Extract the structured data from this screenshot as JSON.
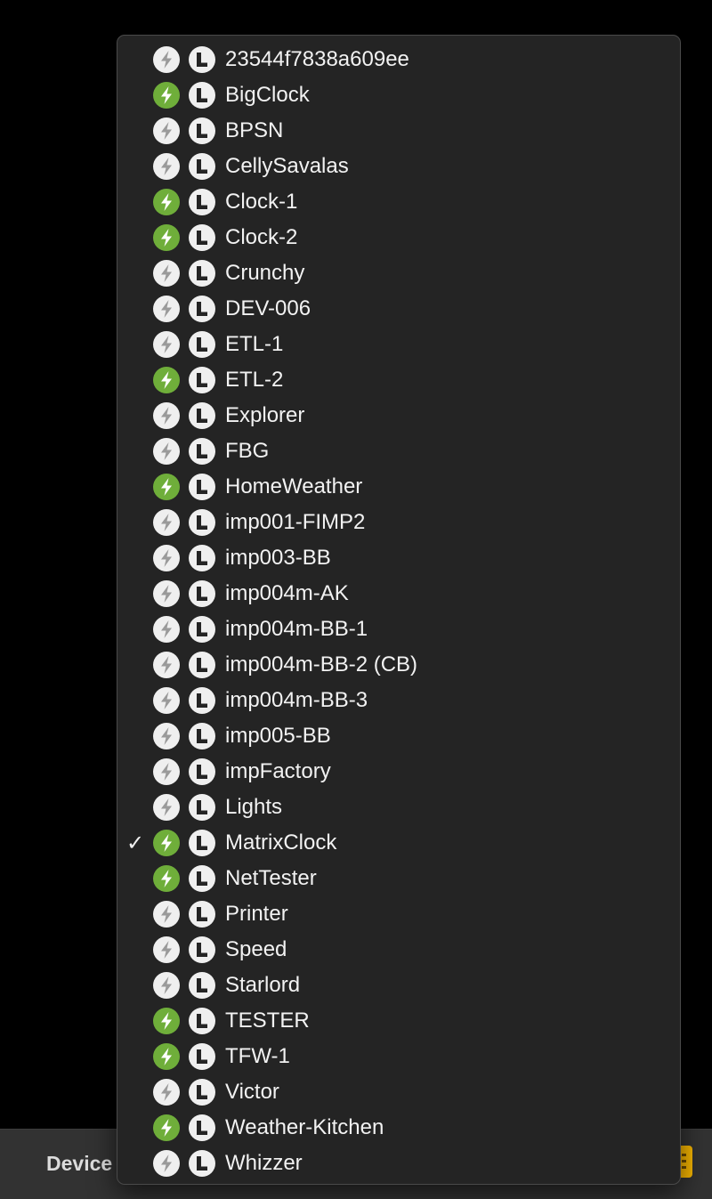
{
  "bottom_bar": {
    "label": "Device"
  },
  "menu": {
    "items": [
      {
        "label": "23544f7838a609ee",
        "online": false,
        "selected": false
      },
      {
        "label": "BigClock",
        "online": true,
        "selected": false
      },
      {
        "label": "BPSN",
        "online": false,
        "selected": false
      },
      {
        "label": "CellySavalas",
        "online": false,
        "selected": false
      },
      {
        "label": "Clock-1",
        "online": true,
        "selected": false
      },
      {
        "label": "Clock-2",
        "online": true,
        "selected": false
      },
      {
        "label": "Crunchy",
        "online": false,
        "selected": false
      },
      {
        "label": "DEV-006",
        "online": false,
        "selected": false
      },
      {
        "label": "ETL-1",
        "online": false,
        "selected": false
      },
      {
        "label": "ETL-2",
        "online": true,
        "selected": false
      },
      {
        "label": "Explorer",
        "online": false,
        "selected": false
      },
      {
        "label": "FBG",
        "online": false,
        "selected": false
      },
      {
        "label": "HomeWeather",
        "online": true,
        "selected": false
      },
      {
        "label": "imp001-FIMP2",
        "online": false,
        "selected": false
      },
      {
        "label": "imp003-BB",
        "online": false,
        "selected": false
      },
      {
        "label": "imp004m-AK",
        "online": false,
        "selected": false
      },
      {
        "label": "imp004m-BB-1",
        "online": false,
        "selected": false
      },
      {
        "label": "imp004m-BB-2 (CB)",
        "online": false,
        "selected": false
      },
      {
        "label": "imp004m-BB-3",
        "online": false,
        "selected": false
      },
      {
        "label": "imp005-BB",
        "online": false,
        "selected": false
      },
      {
        "label": "impFactory",
        "online": false,
        "selected": false
      },
      {
        "label": "Lights",
        "online": false,
        "selected": false
      },
      {
        "label": "MatrixClock",
        "online": true,
        "selected": true
      },
      {
        "label": "NetTester",
        "online": true,
        "selected": false
      },
      {
        "label": "Printer",
        "online": false,
        "selected": false
      },
      {
        "label": "Speed",
        "online": false,
        "selected": false
      },
      {
        "label": "Starlord",
        "online": false,
        "selected": false
      },
      {
        "label": "TESTER",
        "online": true,
        "selected": false
      },
      {
        "label": "TFW-1",
        "online": true,
        "selected": false
      },
      {
        "label": "Victor",
        "online": false,
        "selected": false
      },
      {
        "label": "Weather-Kitchen",
        "online": true,
        "selected": false
      },
      {
        "label": "Whizzer",
        "online": false,
        "selected": false
      }
    ],
    "checkmark_glyph": "✓",
    "status_icon": "lightning-bolt-icon",
    "type_icon": "letter-l-icon"
  },
  "colors": {
    "online": "#6fae3a",
    "offline": "#efefef",
    "menu_background": "#242424",
    "accent": "#f4b400"
  }
}
